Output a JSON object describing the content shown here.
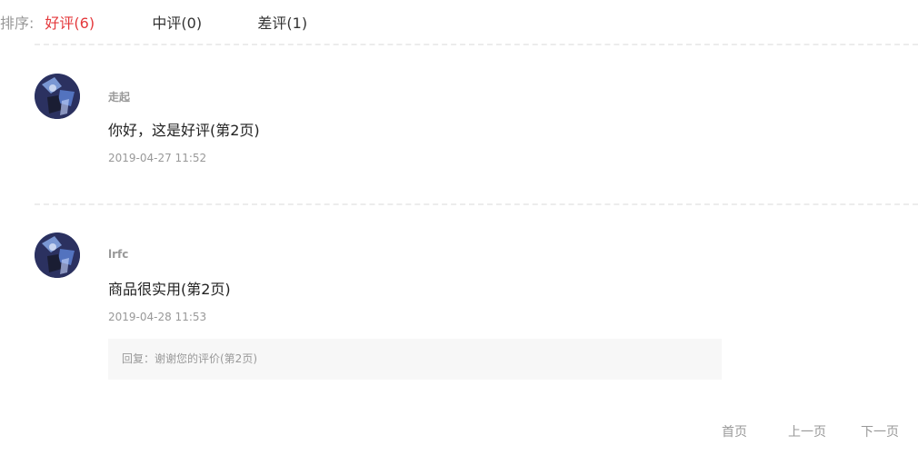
{
  "sort": {
    "label": "排序:",
    "tabs": [
      {
        "label": "好评(6)",
        "active": true
      },
      {
        "label": "中评(0)",
        "active": false
      },
      {
        "label": "差评(1)",
        "active": false
      }
    ],
    "active_color": "#e4393c"
  },
  "comments": [
    {
      "username": "走起",
      "content": "你好，这是好评(第2页)",
      "time": "2019-04-27 11:52"
    },
    {
      "username": "lrfc",
      "content": "商品很实用(第2页)",
      "time": "2019-04-28 11:53",
      "reply": "回复：谢谢您的评价(第2页)"
    }
  ],
  "pagination": {
    "first": "首页",
    "prev": "上一页",
    "next": "下一页"
  }
}
